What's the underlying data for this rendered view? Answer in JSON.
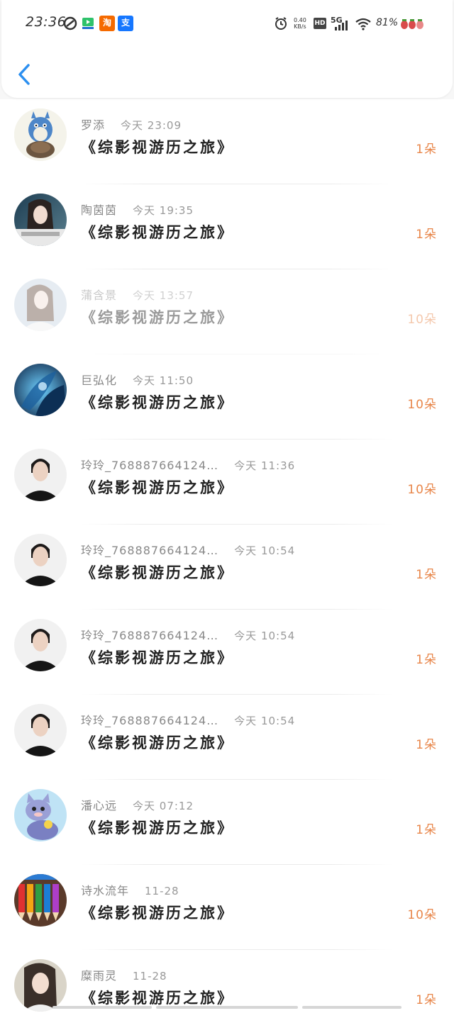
{
  "status_bar": {
    "time": "23:36",
    "net_speed_value": "0.40",
    "net_speed_unit": "KB/s",
    "hd": "HD",
    "network": "5G",
    "battery": "81%",
    "apps": [
      "taobao-app",
      "alipay-app"
    ],
    "taobao_glyph": "淘",
    "alipay_glyph": "支"
  },
  "accent_color": "#e8864a",
  "back_icon": "chevron-left-icon",
  "records": [
    {
      "name": "罗添",
      "time": "今天 23:09",
      "book": "《综影视游历之旅》",
      "amount": "1朵"
    },
    {
      "name": "陶茵茵",
      "time": "今天 19:35",
      "book": "《综影视游历之旅》",
      "amount": "1朵"
    },
    {
      "name": "蒲含景",
      "time": "今天 13:57",
      "book": "《综影视游历之旅》",
      "amount": "10朵"
    },
    {
      "name": "巨弘化",
      "time": "今天 11:50",
      "book": "《综影视游历之旅》",
      "amount": "10朵"
    },
    {
      "name": "玲玲_768887664124…",
      "time": "今天 11:36",
      "book": "《综影视游历之旅》",
      "amount": "10朵"
    },
    {
      "name": "玲玲_768887664124…",
      "time": "今天 10:54",
      "book": "《综影视游历之旅》",
      "amount": "1朵"
    },
    {
      "name": "玲玲_768887664124…",
      "time": "今天 10:54",
      "book": "《综影视游历之旅》",
      "amount": "1朵"
    },
    {
      "name": "玲玲_768887664124…",
      "time": "今天 10:54",
      "book": "《综影视游历之旅》",
      "amount": "1朵"
    },
    {
      "name": "潘心远",
      "time": "今天 07:12",
      "book": "《综影视游历之旅》",
      "amount": "1朵"
    },
    {
      "name": "诗水流年",
      "time": "11-28",
      "book": "《综影视游历之旅》",
      "amount": "10朵"
    },
    {
      "name": "糜雨灵",
      "time": "11-28",
      "book": "《综影视游历之旅》",
      "amount": "1朵"
    }
  ]
}
